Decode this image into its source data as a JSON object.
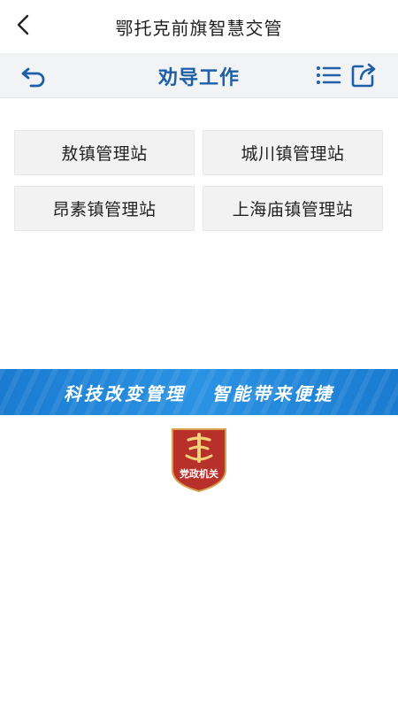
{
  "app": {
    "title": "鄂托克前旗智慧交管"
  },
  "toolbar": {
    "title": "劝导工作"
  },
  "stations": [
    {
      "label": "敖镇管理站"
    },
    {
      "label": "城川镇管理站"
    },
    {
      "label": "昂素镇管理站"
    },
    {
      "label": "上海庙镇管理站"
    }
  ],
  "banner": {
    "slogan": "科技改变管理   智能带来便捷"
  },
  "emblem": {
    "label": "党政机关"
  },
  "colors": {
    "accent": "#1d5fa8",
    "banner": "#1a7bd0",
    "emblem": "#b8302a"
  },
  "icons": [
    "chevron-left-icon",
    "undo-arrow-icon",
    "list-icon",
    "share-icon"
  ]
}
